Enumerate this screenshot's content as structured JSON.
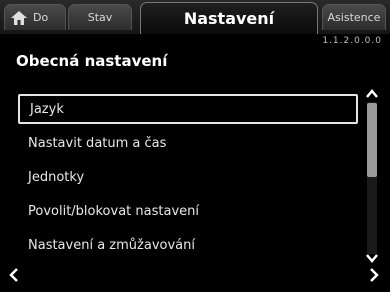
{
  "tabs": {
    "home_label": "Do",
    "status_label": "Stav",
    "active_label": "Nastavení",
    "assist_label": "Asistence"
  },
  "header": {
    "subtitle": "1.1.2.0.0.0",
    "section_title": "Obecná nastavení"
  },
  "list": {
    "items": [
      {
        "label": "Jazyk"
      },
      {
        "label": "Nastavit datum a čas"
      },
      {
        "label": "Jednotky"
      },
      {
        "label": "Povolit/blokovat nastavení"
      },
      {
        "label": "Nastavení a zmůžavování"
      }
    ],
    "selected_index": 0
  },
  "scrollbar": {
    "position_fraction": 0.0,
    "visible_fraction": 0.5
  },
  "icons": {
    "home": "house-icon",
    "scroll_up": "chevron-up-icon",
    "scroll_down": "chevron-down-icon",
    "back": "chevron-left-icon",
    "forward": "chevron-right-icon"
  },
  "colors": {
    "background": "#000000",
    "highlight_border": "#e6e6e6",
    "scroll_thumb": "#9a9a9a"
  }
}
